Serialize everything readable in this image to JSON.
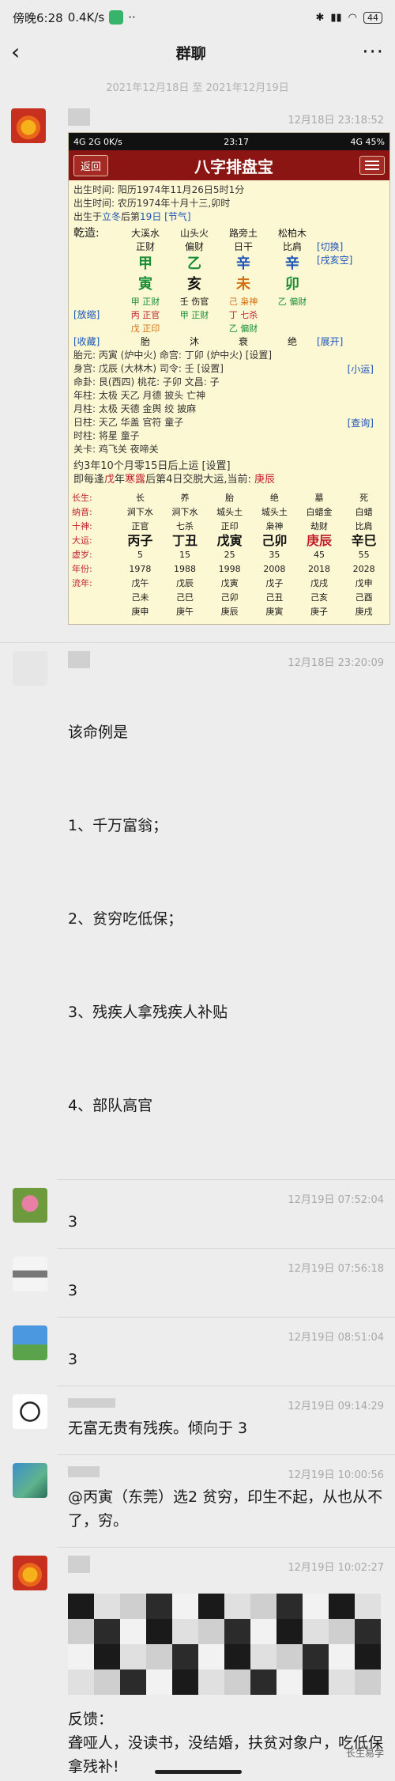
{
  "status": {
    "time": "傍晚6:28",
    "speed": "0.4K/s",
    "dots": "··",
    "battery": "44"
  },
  "nav": {
    "back": "‹",
    "title": "群聊",
    "more": "···"
  },
  "date_range": "2021年12月18日 至 2021年12月19日",
  "messages": [
    {
      "time": "12月18日 23:18:52"
    },
    {
      "time": "12月18日 23:20:09",
      "lines": [
        "该命例是",
        "1、千万富翁；",
        "2、贫穷吃低保；",
        "3、残疾人拿残疾人补贴",
        "4、部队高官"
      ]
    },
    {
      "time": "12月19日 07:52:04",
      "text": "3"
    },
    {
      "time": "12月19日 07:56:18",
      "text": "3"
    },
    {
      "time": "12月19日 08:51:04",
      "text": "3"
    },
    {
      "time": "12月19日 09:14:29",
      "text": "无富无贵有残疾。倾向于 3"
    },
    {
      "time": "12月19日 10:00:56",
      "text": "@丙寅（东莞）选2 贫穷，印生不起，从也从不了，穷。"
    },
    {
      "time": "12月19日 10:02:27",
      "text": "反馈：\n聋哑人，没读书，没结婚，扶贫对象户，吃低保拿残补!\n\n个人认为，这个八字很反常，走两个极端：要么千万富豪，要么贫穷"
    }
  ],
  "shot": {
    "sbar_left": "4G 2G 0K/s",
    "sbar_time": "23:17",
    "sbar_right": "4G 45%",
    "back": "返回",
    "logo": "八字排盘宝",
    "birth1": "出生时间: 阳历1974年11月26日5时1分",
    "birth2": "出生时间: 农历1974年十月十三,卯时",
    "birth3a": "出生于",
    "birth3b": "立冬",
    "birth3c": "后第",
    "birth3d": "19",
    "birth3e": "日 [节气]",
    "qianzao": "乾造:",
    "nayin": [
      "大溪水",
      "山头火",
      "路旁土",
      "松柏木"
    ],
    "shishen": [
      "正财",
      "偏财",
      "日干",
      "比肩"
    ],
    "stems": [
      "甲",
      "乙",
      "辛",
      "辛"
    ],
    "branches": [
      "寅",
      "亥",
      "未",
      "卯"
    ],
    "hidden1": [
      "甲 正财",
      "壬 伤官",
      "己 枭神",
      "乙 偏财"
    ],
    "hidden2": [
      "丙 正官",
      "甲 正财",
      "丁 七杀",
      ""
    ],
    "hidden3": [
      "戊 正印",
      "",
      "乙 偏财",
      ""
    ],
    "states": [
      "胎",
      "沐",
      "衰",
      "绝"
    ],
    "side_left": [
      "[放缩]",
      "[收藏]"
    ],
    "side_right": [
      "[切换]",
      "[戌亥空]",
      "[展开]",
      "[小运]",
      "[查询]"
    ],
    "info": [
      "胎元: 丙寅 (炉中火) 命宫: 丁卯 (炉中火) [设置]",
      "身宫: 戊辰 (大林木) 司令: 壬 [设置]",
      "命卦: 艮(西四) 桃花: 子卯 文昌: 子",
      "年柱: 太极 天乙 月德 披头 亡神",
      "月柱: 太极 天德 金舆 绞 披麻",
      "日柱: 天乙 华盖 官符 童子",
      "时柱: 将星 童子",
      "关卡: 鸡飞关 夜啼关"
    ],
    "yun1": "约3年10个月零15日后上运 [设置]",
    "yun2a": "即每逢",
    "yun2b": "戊",
    "yun2c": "年",
    "yun2d": "寒露",
    "yun2e": "后第4日交脱大运,当前: ",
    "yun2f": "庚辰",
    "luck_labels": [
      "长生:",
      "纳音:",
      "十神:",
      "大运:",
      "虚岁:",
      "年份:",
      "流年:",
      "",
      ""
    ],
    "luck_cols": [
      [
        "长",
        "涧下水",
        "正官",
        "丙子",
        "5",
        "1978",
        "戊午",
        "己未",
        "庚申"
      ],
      [
        "养",
        "涧下水",
        "七杀",
        "丁丑",
        "15",
        "1988",
        "戊辰",
        "己巳",
        "庚午"
      ],
      [
        "胎",
        "城头土",
        "正印",
        "戊寅",
        "25",
        "1998",
        "戊寅",
        "己卯",
        "庚辰"
      ],
      [
        "绝",
        "城头土",
        "枭神",
        "己卯",
        "35",
        "2008",
        "戊子",
        "己丑",
        "庚寅"
      ],
      [
        "墓",
        "白蜡金",
        "劫财",
        "庚辰",
        "45",
        "2018",
        "戊戌",
        "己亥",
        "庚子"
      ],
      [
        "死",
        "白蜡",
        "比肩",
        "辛巳",
        "55",
        "2028",
        "戊申",
        "己酉",
        "庚戌"
      ]
    ]
  },
  "watermark": "长生易学"
}
